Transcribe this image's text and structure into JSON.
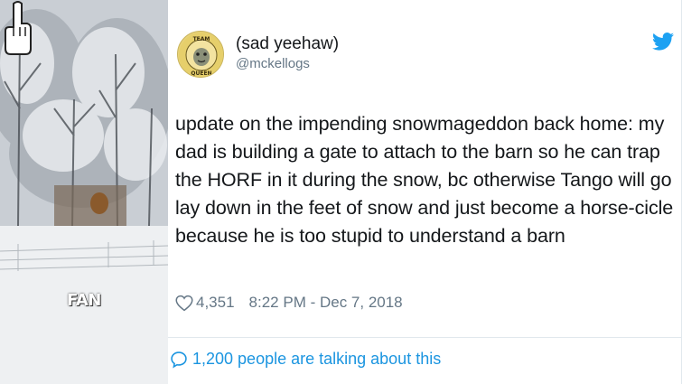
{
  "user": {
    "display_name": "(sad yeehaw)",
    "handle": "@mckellogs",
    "avatar_text_top": "TEAM",
    "avatar_text_bottom": "QUEEN"
  },
  "tweet": {
    "text": "update on the impending snowmageddon back home: my dad is building a gate to attach to the barn so he can trap the HORF in it during the snow, bc otherwise Tango will go lay down in the feet of snow and just become a horse-cicle because he is too stupid to understand a barn",
    "likes": "4,351",
    "timestamp": "8:22 PM - Dec 7, 2018",
    "talking": "1,200 people are talking about this"
  },
  "badge": {
    "label": "FAN"
  },
  "colors": {
    "accent": "#1b95e0",
    "twitter_blue": "#1da1f2",
    "muted": "#657786",
    "text": "#14171a"
  },
  "icons": [
    "twitter-bird-icon",
    "heart-icon",
    "speech-bubble-icon",
    "foam-finger-icon"
  ]
}
